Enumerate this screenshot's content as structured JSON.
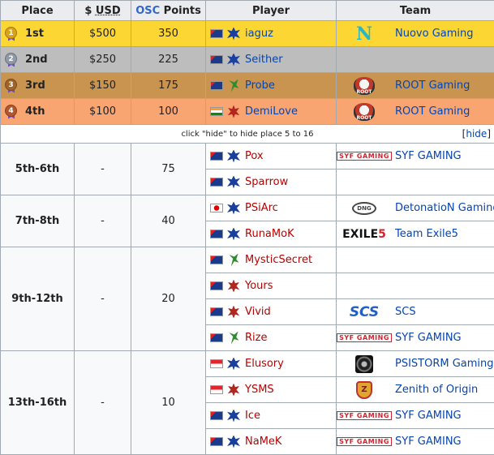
{
  "header": {
    "place": "Place",
    "usd_prefix": "$ ",
    "usd": "USD",
    "osc": "OSC",
    "points_suffix": " Points",
    "player": "Player",
    "team": "Team"
  },
  "top_rows": [
    {
      "place": "1st",
      "medal_digit": "1",
      "usd": "$500",
      "points": "350",
      "flag": "au",
      "race": "terran",
      "player": "iaguz",
      "player_color": "blue",
      "team_logo": "nuovo",
      "team": "Nuovo Gaming"
    },
    {
      "place": "2nd",
      "medal_digit": "2",
      "usd": "$250",
      "points": "225",
      "flag": "au",
      "race": "terran",
      "player": "Seither",
      "player_color": "blue",
      "team_logo": "",
      "team": ""
    },
    {
      "place": "3rd",
      "medal_digit": "3",
      "usd": "$150",
      "points": "175",
      "flag": "au",
      "race": "protoss",
      "player": "Probe",
      "player_color": "blue",
      "team_logo": "root",
      "team": "ROOT Gaming"
    },
    {
      "place": "4th",
      "medal_digit": "4",
      "usd": "$100",
      "points": "100",
      "flag": "in",
      "race": "zerg",
      "player": "DemiLove",
      "player_color": "blue",
      "team_logo": "root",
      "team": "ROOT Gaming"
    }
  ],
  "hide_row": {
    "message": "click \"hide\" to hide place 5 to 16",
    "link_open": "[",
    "link": "hide",
    "link_close": "]"
  },
  "logos": {
    "nuovo": "N",
    "root": "ROOT",
    "syf": "SYF GAMING",
    "dng": "DNG",
    "exile_a": "EXILE",
    "exile_b": "5",
    "scs": "SCS",
    "zenith": "Z"
  },
  "groups": [
    {
      "place": "5th-6th",
      "usd": "-",
      "points": "75",
      "players": [
        {
          "flag": "au",
          "race": "terran",
          "name": "Pox",
          "team_logo": "syf",
          "team": "SYF GAMING"
        },
        {
          "flag": "au",
          "race": "terran",
          "name": "Sparrow",
          "team_logo": "",
          "team": ""
        }
      ]
    },
    {
      "place": "7th-8th",
      "usd": "-",
      "points": "40",
      "players": [
        {
          "flag": "jp",
          "race": "terran",
          "name": "PSiArc",
          "team_logo": "dng",
          "team": "DetonatioN Gaming"
        },
        {
          "flag": "au",
          "race": "terran",
          "name": "RunaMoK",
          "team_logo": "exile",
          "team": "Team Exile5"
        }
      ]
    },
    {
      "place": "9th-12th",
      "usd": "-",
      "points": "20",
      "players": [
        {
          "flag": "au",
          "race": "protoss",
          "name": "MysticSecret",
          "team_logo": "",
          "team": ""
        },
        {
          "flag": "au",
          "race": "zerg",
          "name": "Yours",
          "team_logo": "",
          "team": ""
        },
        {
          "flag": "au",
          "race": "zerg",
          "name": "Vivid",
          "team_logo": "scs",
          "team": "SCS"
        },
        {
          "flag": "au",
          "race": "protoss",
          "name": "Rize",
          "team_logo": "syf",
          "team": "SYF GAMING"
        }
      ]
    },
    {
      "place": "13th-16th",
      "usd": "-",
      "points": "10",
      "players": [
        {
          "flag": "sg",
          "race": "terran",
          "name": "Elusory",
          "team_logo": "psistorm",
          "team": "PSISTORM Gaming"
        },
        {
          "flag": "sg",
          "race": "zerg",
          "name": "YSMS",
          "team_logo": "zenith",
          "team": "Zenith of Origin"
        },
        {
          "flag": "au",
          "race": "terran",
          "name": "Ice",
          "team_logo": "syf",
          "team": "SYF GAMING"
        },
        {
          "flag": "au",
          "race": "terran",
          "name": "NaMeK",
          "team_logo": "syf",
          "team": "SYF GAMING"
        }
      ]
    }
  ]
}
